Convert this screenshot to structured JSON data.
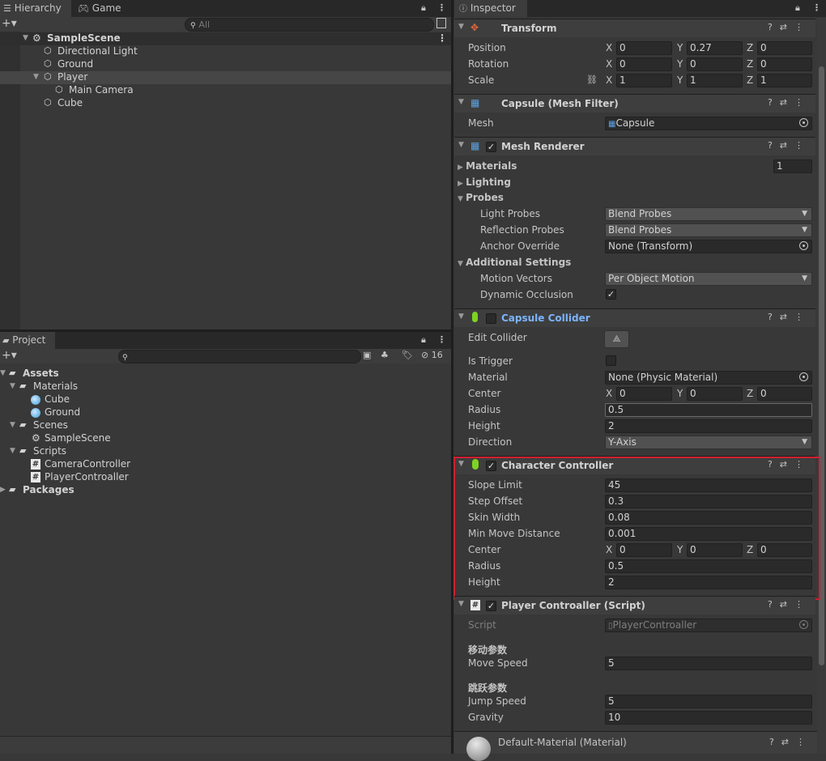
{
  "hierarchy": {
    "tab_label": "Hierarchy",
    "game_tab_label": "Game",
    "search_placeholder": "All",
    "scene": "SampleScene",
    "items": [
      "Directional Light",
      "Ground",
      "Player",
      "Main Camera",
      "Cube"
    ]
  },
  "project": {
    "tab_label": "Project",
    "hidden_count": "16",
    "tree": [
      "Assets",
      "Materials",
      "Cube",
      "Ground",
      "Scenes",
      "SampleScene",
      "Scripts",
      "CameraController",
      "PlayerControaller",
      "Packages"
    ]
  },
  "inspector": {
    "tab_label": "Inspector",
    "transform": {
      "title": "Transform",
      "position_label": "Position",
      "rotation_label": "Rotation",
      "scale_label": "Scale",
      "axis_x": "X",
      "axis_y": "Y",
      "axis_z": "Z",
      "position": [
        "0",
        "0.27",
        "0"
      ],
      "rotation": [
        "0",
        "0",
        "0"
      ],
      "scale": [
        "1",
        "1",
        "1"
      ]
    },
    "mesh_filter": {
      "title": "Capsule (Mesh Filter)",
      "mesh_label": "Mesh",
      "mesh_value": "Capsule"
    },
    "mesh_renderer": {
      "title": "Mesh Renderer",
      "materials_label": "Materials",
      "materials_count": "1",
      "lighting_label": "Lighting",
      "probes_label": "Probes",
      "light_probes_label": "Light Probes",
      "light_probes_value": "Blend Probes",
      "reflection_probes_label": "Reflection Probes",
      "reflection_probes_value": "Blend Probes",
      "anchor_override_label": "Anchor Override",
      "anchor_override_value": "None (Transform)",
      "additional_settings_label": "Additional Settings",
      "motion_vectors_label": "Motion Vectors",
      "motion_vectors_value": "Per Object Motion",
      "dynamic_occlusion_label": "Dynamic Occlusion"
    },
    "capsule_collider": {
      "title": "Capsule Collider",
      "edit_collider_label": "Edit Collider",
      "is_trigger_label": "Is Trigger",
      "material_label": "Material",
      "material_value": "None (Physic Material)",
      "center_label": "Center",
      "center": [
        "0",
        "0",
        "0"
      ],
      "radius_label": "Radius",
      "radius": "0.5",
      "height_label": "Height",
      "height": "2",
      "direction_label": "Direction",
      "direction": "Y-Axis"
    },
    "character_controller": {
      "title": "Character Controller",
      "slope_limit_label": "Slope Limit",
      "slope_limit": "45",
      "step_offset_label": "Step Offset",
      "step_offset": "0.3",
      "skin_width_label": "Skin Width",
      "skin_width": "0.08",
      "min_move_distance_label": "Min Move Distance",
      "min_move_distance": "0.001",
      "center_label": "Center",
      "center": [
        "0",
        "0",
        "0"
      ],
      "radius_label": "Radius",
      "radius": "0.5",
      "height_label": "Height",
      "height": "2"
    },
    "player_controller": {
      "title": "Player Controaller (Script)",
      "script_label": "Script",
      "script_value": "PlayerControaller",
      "move_header": "移动参数",
      "move_speed_label": "Move Speed",
      "move_speed": "5",
      "jump_header": "跳跃参数",
      "jump_speed_label": "Jump Speed",
      "jump_speed": "5",
      "gravity_label": "Gravity",
      "gravity": "10"
    },
    "material": {
      "title": "Default-Material (Material)"
    }
  },
  "colors": {
    "highlight": "#d02030",
    "accent_text": "#7cb4ff",
    "bg": "#383838"
  }
}
